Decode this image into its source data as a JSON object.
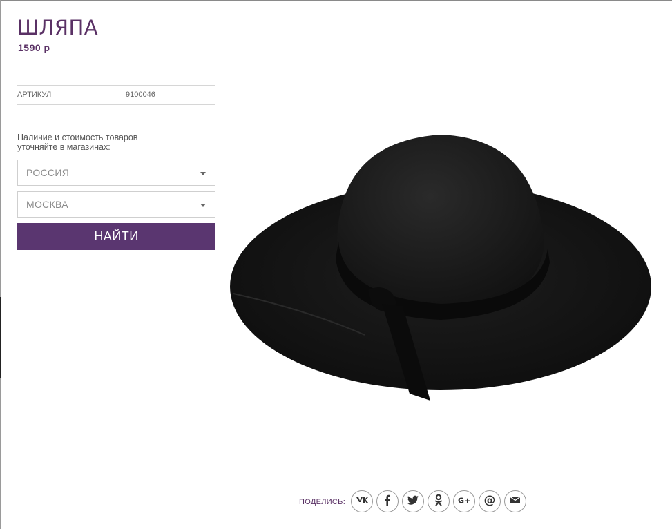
{
  "product": {
    "title": "ШЛЯПА",
    "price": "1590 р",
    "sku_label": "АРТИКУЛ",
    "sku_value": "9100046"
  },
  "availability": {
    "text": "Наличие и стоимость товаров уточняйте в магазинах:"
  },
  "filters": {
    "country": {
      "value": "РОССИЯ"
    },
    "city": {
      "value": "МОСКВА"
    },
    "find_label": "НАЙТИ"
  },
  "share": {
    "label": "ПОДЕЛИСЬ:",
    "icons": [
      "vk-icon",
      "facebook-icon",
      "twitter-icon",
      "odnoklassniki-icon",
      "google-plus-icon",
      "mail-ru-icon",
      "email-icon"
    ]
  },
  "colors": {
    "brand": "#5a3165",
    "button": "#5a3670"
  }
}
